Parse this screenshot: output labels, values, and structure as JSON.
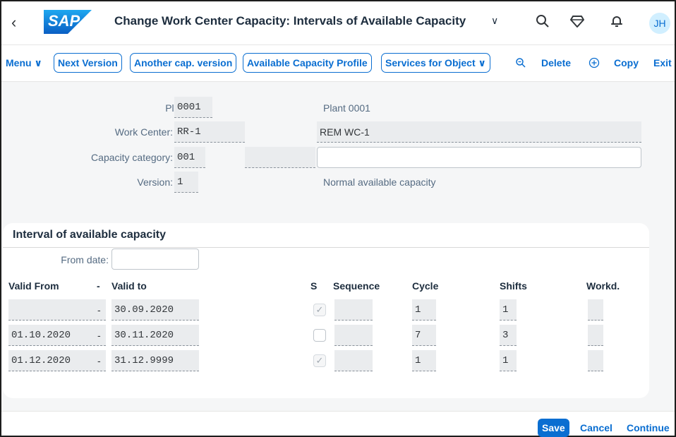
{
  "shell": {
    "back": "‹",
    "logo": "SAP",
    "title": "Change Work Center Capacity: Intervals of Available Capacity",
    "title_chevron": "∨",
    "avatar": "JH",
    "icons": [
      "search-icon",
      "diamond-icon",
      "bell-icon"
    ]
  },
  "toolbar": {
    "menu": "Menu ∨",
    "next_version": "Next Version",
    "another_version": "Another cap. version",
    "available_profile": "Available Capacity Profile",
    "services": "Services for Object ∨",
    "delete": "Delete",
    "copy": "Copy",
    "exit": "Exit"
  },
  "header": {
    "plant_label": "Plant:",
    "plant_value": "0001",
    "plant_desc": "Plant 0001",
    "wc_label": "Work Center:",
    "wc_value": "RR-1",
    "wc_desc": "REM WC-1",
    "capcat_label": "Capacity category:",
    "capcat_value": "001",
    "capcat_text": "",
    "capcat_desc": "",
    "version_label": "Version:",
    "version_value": "1",
    "version_desc": "Normal available capacity"
  },
  "interval": {
    "title": "Interval of available capacity",
    "from_date_label": "From date:",
    "from_date_value": "",
    "columns": {
      "valid_from": "Valid From",
      "dash": "-",
      "valid_to": "Valid to",
      "s": "S",
      "sequence": "Sequence",
      "cycle": "Cycle",
      "shifts": "Shifts",
      "workd": "Workd."
    },
    "rows": [
      {
        "valid_from": "",
        "dash": "-",
        "valid_to": "30.09.2020",
        "s": true,
        "sequence": "",
        "cycle": "1",
        "shifts": "1",
        "workd": ""
      },
      {
        "valid_from": "01.10.2020",
        "dash": "-",
        "valid_to": "30.11.2020",
        "s": false,
        "sequence": "",
        "cycle": "7",
        "shifts": "3",
        "workd": ""
      },
      {
        "valid_from": "01.12.2020",
        "dash": "-",
        "valid_to": "31.12.9999",
        "s": true,
        "sequence": "",
        "cycle": "1",
        "shifts": "1",
        "workd": ""
      }
    ]
  },
  "footer": {
    "save": "Save",
    "cancel": "Cancel",
    "continue": "Continue"
  },
  "colors": {
    "accent": "#0a6ed1",
    "logo_bg": "#1a7fd4",
    "avatar_bg": "#d1efff"
  }
}
